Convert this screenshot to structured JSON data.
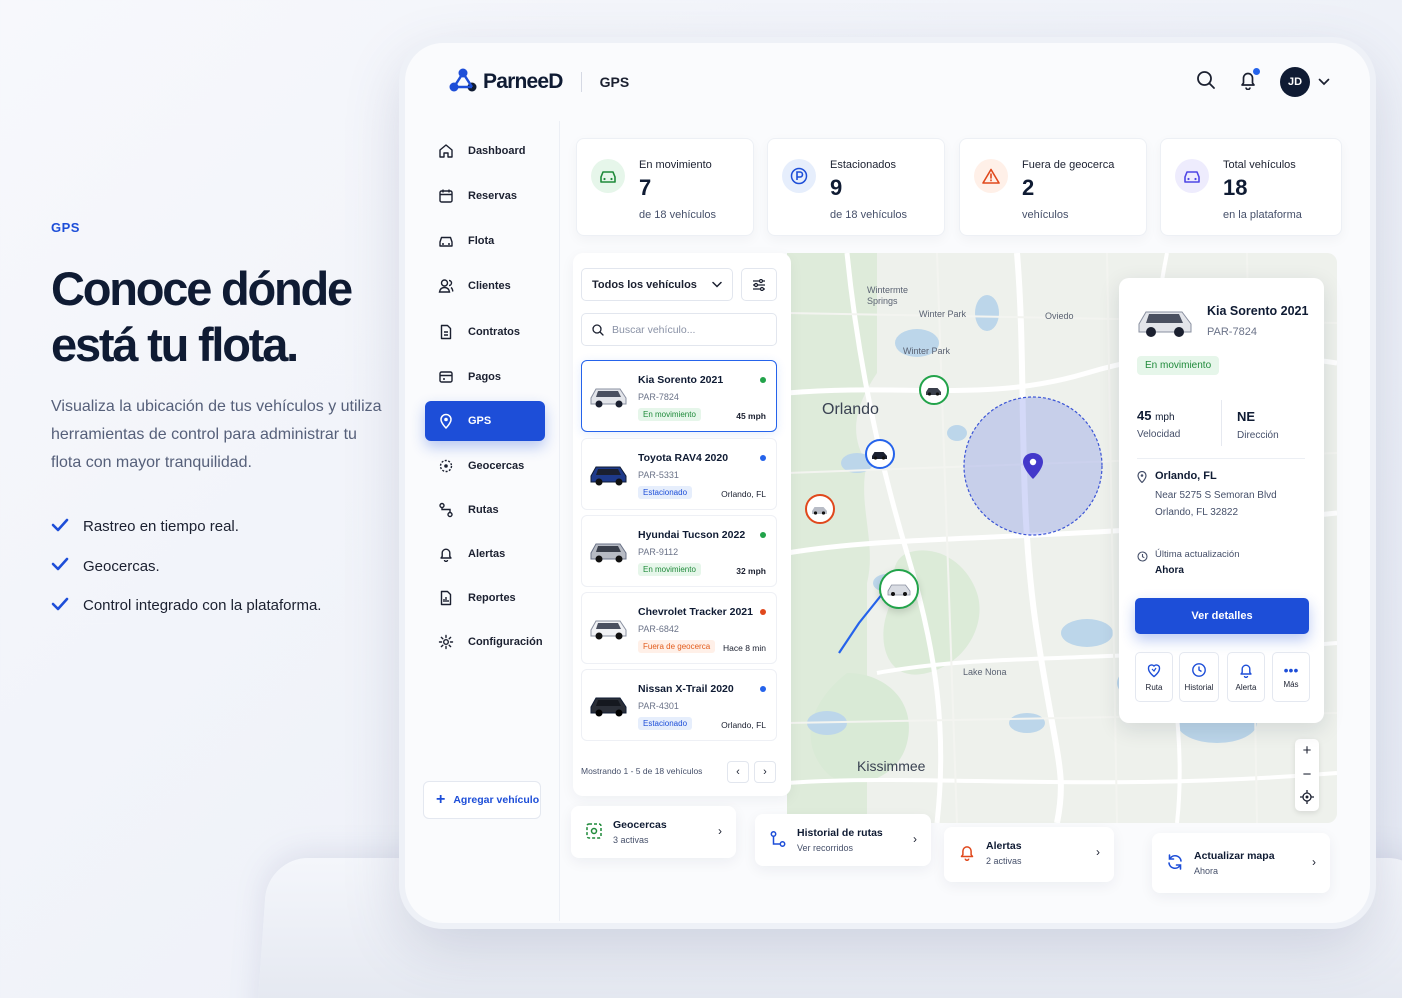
{
  "promo": {
    "eyebrow": "GPS",
    "title_line1": "Conoce dónde",
    "title_line2": "está tu flota.",
    "description": "Visualiza la ubicación de tus vehículos y utiliza herramientas de control para administrar tu flota con mayor tranquilidad.",
    "features": [
      "Rastreo en tiempo real.",
      "Geocercas.",
      "Control integrado con la plataforma."
    ]
  },
  "header": {
    "brand": "ParneeD",
    "section": "GPS",
    "avatar_initials": "JD"
  },
  "sidebar": {
    "items": [
      {
        "label": "Dashboard",
        "icon": "home-icon"
      },
      {
        "label": "Reservas",
        "icon": "calendar-icon"
      },
      {
        "label": "Flota",
        "icon": "car-icon"
      },
      {
        "label": "Clientes",
        "icon": "users-icon"
      },
      {
        "label": "Contratos",
        "icon": "document-icon"
      },
      {
        "label": "Pagos",
        "icon": "wallet-icon"
      },
      {
        "label": "GPS",
        "icon": "location-pin-icon",
        "active": true
      },
      {
        "label": "Geocercas",
        "icon": "geofence-icon"
      },
      {
        "label": "Rutas",
        "icon": "route-icon"
      },
      {
        "label": "Alertas",
        "icon": "bell-icon"
      },
      {
        "label": "Reportes",
        "icon": "report-icon"
      },
      {
        "label": "Configuración",
        "icon": "gear-icon"
      }
    ],
    "add_vehicle": "Agregar vehículo"
  },
  "stats": [
    {
      "label": "En movimiento",
      "value": "7",
      "sub": "de 18 vehículos",
      "color": "#1f8a3a"
    },
    {
      "label": "Estacionados",
      "value": "9",
      "sub": "de 18 vehículos",
      "color": "#1d4ed8"
    },
    {
      "label": "Fuera de geocerca",
      "value": "2",
      "sub": "vehículos",
      "color": "#e25c1c"
    },
    {
      "label": "Total vehículos",
      "value": "18",
      "sub": "en la plataforma",
      "color": "#4f46e5"
    }
  ],
  "vehicle_list": {
    "filter_value": "Todos los vehículos",
    "search_placeholder": "Buscar vehículo...",
    "vehicles": [
      {
        "name": "Kia Sorento 2021",
        "plate": "PAR-7824",
        "status": "En movimiento",
        "meta": "45 mph",
        "dot": "#22a34a"
      },
      {
        "name": "Toyota RAV4 2020",
        "plate": "PAR-5331",
        "status": "Estacionado",
        "meta": "Orlando, FL",
        "dot": "#2563eb"
      },
      {
        "name": "Hyundai Tucson 2022",
        "plate": "PAR-9112",
        "status": "En movimiento",
        "meta": "32 mph",
        "dot": "#22a34a"
      },
      {
        "name": "Chevrolet Tracker 2021",
        "plate": "PAR-6842",
        "status": "Fuera de geocerca",
        "meta": "Hace 8 min",
        "dot": "#e0481c"
      },
      {
        "name": "Nissan X-Trail 2020",
        "plate": "PAR-4301",
        "status": "Estacionado",
        "meta": "Orlando, FL",
        "dot": "#2563eb"
      }
    ],
    "showing": "Mostrando 1 - 5 de 18 vehículos"
  },
  "map": {
    "labels": [
      "Wintermte Springs",
      "Winter Park",
      "Oviedo",
      "Winter Park",
      "Lake Nona",
      "Orlando",
      "Kissimmee"
    ]
  },
  "detail": {
    "name": "Kia Sorento 2021",
    "plate": "PAR-7824",
    "status": "En movimiento",
    "speed_value": "45",
    "speed_unit": "mph",
    "speed_label": "Velocidad",
    "direction_value": "NE",
    "direction_label": "Dirección",
    "location": "Orlando, FL",
    "address1": "Near 5275 S Semoran Blvd",
    "address2": "Orlando, FL 32822",
    "updated_label": "Última actualización",
    "updated_value": "Ahora",
    "button": "Ver detalles",
    "actions": [
      "Ruta",
      "Historial",
      "Alerta",
      "Más"
    ]
  },
  "quick_cards": [
    {
      "title": "Geocercas",
      "sub": "3 activas"
    },
    {
      "title": "Historial de rutas",
      "sub": "Ver recorridos"
    },
    {
      "title": "Alertas",
      "sub": "2 activas"
    },
    {
      "title": "Actualizar mapa",
      "sub": "Ahora"
    }
  ]
}
